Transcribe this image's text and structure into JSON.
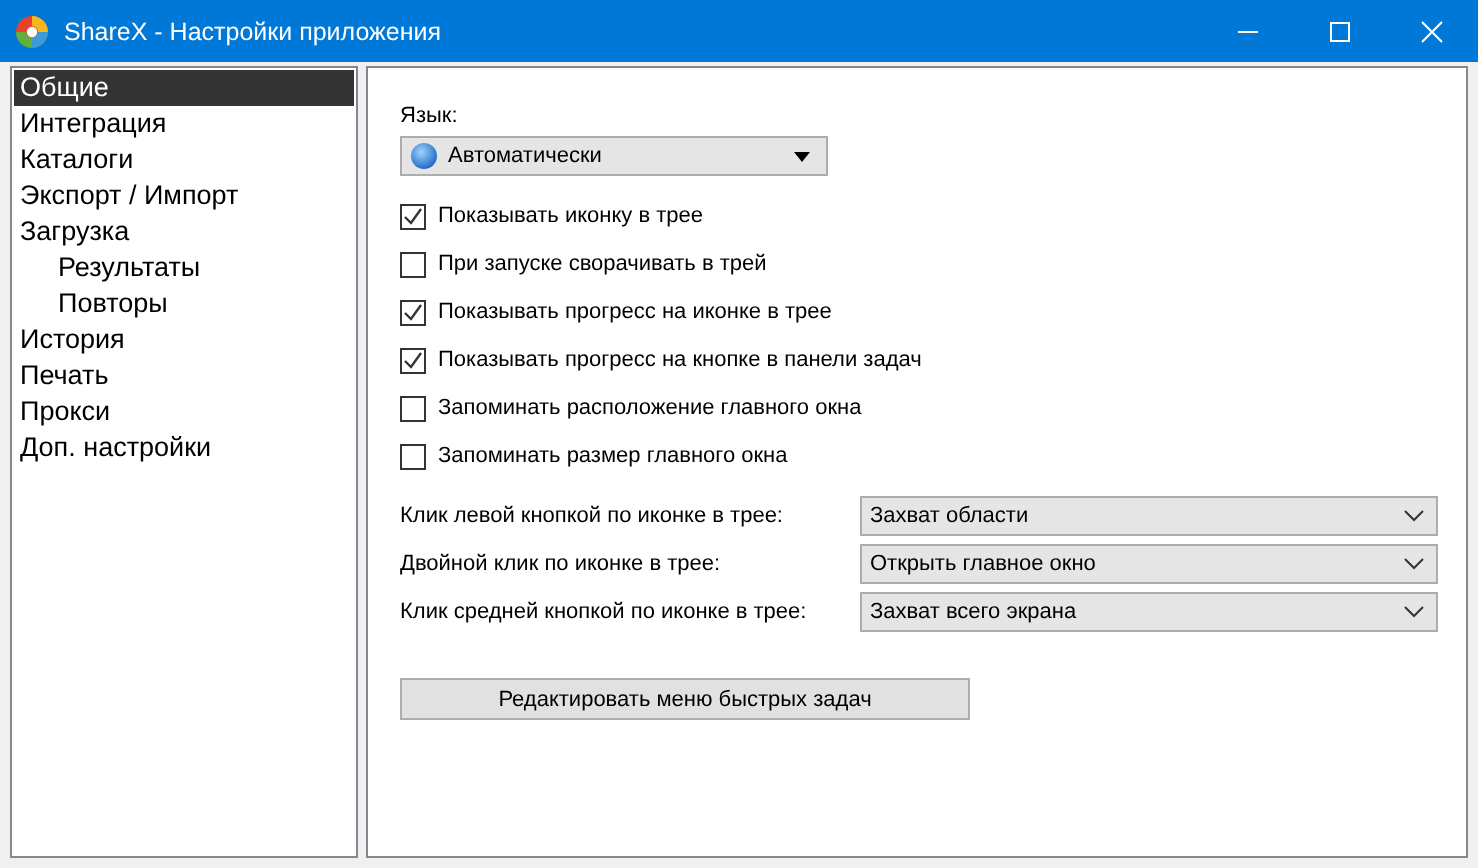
{
  "window": {
    "title": "ShareX - Настройки приложения"
  },
  "sidebar": {
    "items": [
      {
        "label": "Общие",
        "selected": true
      },
      {
        "label": "Интеграция",
        "selected": false
      },
      {
        "label": "Каталоги",
        "selected": false
      },
      {
        "label": "Экспорт / Импорт",
        "selected": false
      },
      {
        "label": "Загрузка",
        "selected": false,
        "children": [
          {
            "label": "Результаты",
            "selected": false
          },
          {
            "label": "Повторы",
            "selected": false
          }
        ]
      },
      {
        "label": "История",
        "selected": false
      },
      {
        "label": "Печать",
        "selected": false
      },
      {
        "label": "Прокси",
        "selected": false
      },
      {
        "label": "Доп. настройки",
        "selected": false
      }
    ]
  },
  "language": {
    "label": "Язык:",
    "value": "Автоматически"
  },
  "checkboxes": [
    {
      "label": "Показывать иконку в трее",
      "checked": true
    },
    {
      "label": "При запуске сворачивать в трей",
      "checked": false
    },
    {
      "label": "Показывать прогресс на иконке в трее",
      "checked": true
    },
    {
      "label": "Показывать прогресс на кнопке в панели задач",
      "checked": true
    },
    {
      "label": "Запоминать расположение главного окна",
      "checked": false
    },
    {
      "label": "Запоминать размер главного окна",
      "checked": false
    }
  ],
  "tray_actions": [
    {
      "label": "Клик левой кнопкой по иконке в трее:",
      "value": "Захват области"
    },
    {
      "label": "Двойной клик по иконке в трее:",
      "value": "Открыть главное окно"
    },
    {
      "label": "Клик средней кнопкой по иконке в трее:",
      "value": "Захват всего экрана"
    }
  ],
  "button": "Редактировать меню быстрых задач"
}
